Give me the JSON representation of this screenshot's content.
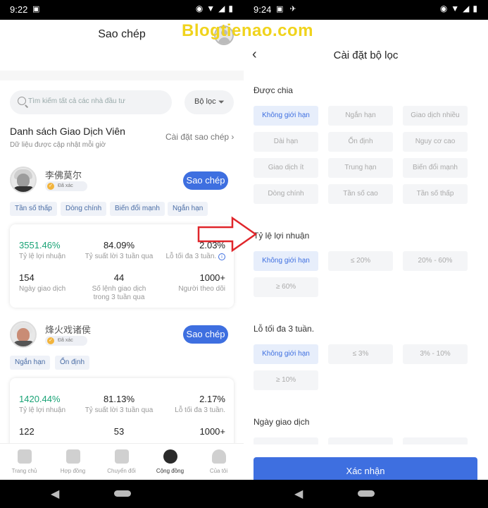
{
  "watermark": "Blogtienao.com",
  "left": {
    "status_time": "9:22",
    "title": "Sao chép",
    "search_placeholder": "Tìm kiếm tất cả các nhà đầu tư",
    "filter_label": "Bộ lọc",
    "list_title": "Danh sách Giao Dịch Viên",
    "list_subtitle": "Dữ liệu được cập nhật mỗi giờ",
    "copy_settings": "Cài đặt sao chép",
    "traders": [
      {
        "name": "李佛莫尔",
        "verified": "Đã xác",
        "copy_label": "Sao chép",
        "tags": [
          "Tần số thấp",
          "Dòng chính",
          "Biến đổi mạnh",
          "Ngắn hạn"
        ],
        "stats": {
          "profit_rate": "3551.46%",
          "profit_rate_label": "Tỷ lệ lợi nhuận",
          "three_week_return": "84.09%",
          "three_week_return_label": "Tỷ suất lời 3 tuần qua",
          "max_loss": "2.03%",
          "max_loss_label": "Lỗ tối đa 3 tuần.",
          "trading_days": "154",
          "trading_days_label": "Ngày giao dịch",
          "orders": "44",
          "orders_label_1": "Số lệnh giao dịch",
          "orders_label_2": "trong 3 tuần qua",
          "followers": "1000+",
          "followers_label": "Người theo dõi"
        }
      },
      {
        "name": "烽火戏诸侯",
        "verified": "Đã xác",
        "copy_label": "Sao chép",
        "tags": [
          "Ngắn hạn",
          "Ổn định"
        ],
        "stats": {
          "profit_rate": "1420.44%",
          "profit_rate_label": "Tỷ lệ lợi nhuận",
          "three_week_return": "81.13%",
          "three_week_return_label": "Tỷ suất lời 3 tuần qua",
          "max_loss": "2.17%",
          "max_loss_label": "Lỗ tối đa 3 tuần.",
          "trading_days": "122",
          "orders": "53",
          "followers": "1000+"
        }
      }
    ],
    "tabs": [
      "Trang chủ",
      "Hợp đồng",
      "Chuyển đổi",
      "Cộng đồng",
      "Của tôi"
    ],
    "active_tab_index": 3
  },
  "right": {
    "status_time": "9:24",
    "title": "Cài đặt bộ lọc",
    "sections": [
      {
        "label": "Được chia",
        "options": [
          "Không giới hạn",
          "Ngắn hạn",
          "Giao dịch nhiều",
          "Dài hạn",
          "Ổn định",
          "Nguy cơ cao",
          "Giao dịch ít",
          "Trung hạn",
          "Biến đổi mạnh",
          "Dòng chính",
          "Tần số cao",
          "Tần số thấp"
        ]
      },
      {
        "label": "Tỷ lệ lợi nhuận",
        "options": [
          "Không giới hạn",
          "≤ 20%",
          "20% - 60%",
          "≥ 60%"
        ]
      },
      {
        "label": "Lỗ tối đa 3 tuần.",
        "options": [
          "Không giới hạn",
          "≤ 3%",
          "3% - 10%",
          "≥ 10%"
        ]
      },
      {
        "label": "Ngày giao dịch",
        "options": []
      }
    ],
    "confirm_label": "Xác nhận"
  },
  "colors": {
    "accent": "#3e6fe0",
    "profit_green": "#1aa376",
    "arrow_red": "#e0262b",
    "watermark_yellow": "#f0d31c"
  }
}
